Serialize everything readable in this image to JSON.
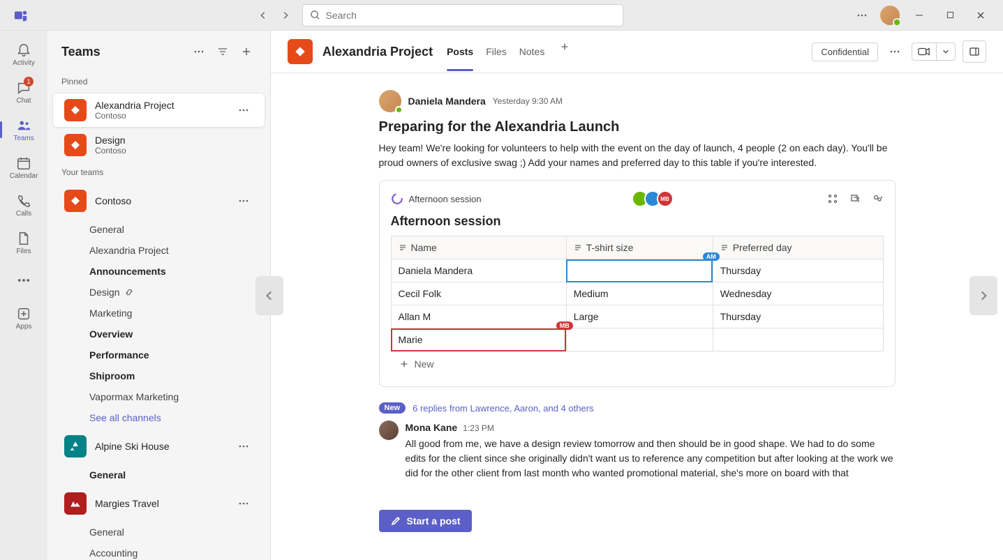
{
  "titlebar": {
    "search_placeholder": "Search"
  },
  "rail": {
    "activity": "Activity",
    "chat": "Chat",
    "chat_badge": "1",
    "teams": "Teams",
    "calendar": "Calendar",
    "calls": "Calls",
    "files": "Files",
    "apps": "Apps"
  },
  "sidebar": {
    "title": "Teams",
    "pinned_label": "Pinned",
    "your_teams_label": "Your teams",
    "pinned": [
      {
        "name": "Alexandria Project",
        "sub": "Contoso"
      },
      {
        "name": "Design",
        "sub": "Contoso"
      }
    ],
    "teams": [
      {
        "name": "Contoso",
        "channels": [
          {
            "label": "General",
            "bold": false
          },
          {
            "label": "Alexandria Project",
            "bold": false
          },
          {
            "label": "Announcements",
            "bold": true
          },
          {
            "label": "Design",
            "bold": false,
            "link": true
          },
          {
            "label": "Marketing",
            "bold": false
          },
          {
            "label": "Overview",
            "bold": true
          },
          {
            "label": "Performance",
            "bold": true
          },
          {
            "label": "Shiproom",
            "bold": true
          },
          {
            "label": "Vapormax Marketing",
            "bold": false
          }
        ],
        "see_all": "See all channels"
      },
      {
        "name": "Alpine Ski House",
        "channels": [
          {
            "label": "General",
            "bold": true
          }
        ]
      },
      {
        "name": "Margies Travel",
        "channels": [
          {
            "label": "General",
            "bold": false
          },
          {
            "label": "Accounting",
            "bold": false
          }
        ]
      }
    ]
  },
  "header": {
    "channel_title": "Alexandria Project",
    "tabs": {
      "posts": "Posts",
      "files": "Files",
      "notes": "Notes"
    },
    "confidential": "Confidential"
  },
  "post": {
    "author": "Daniela Mandera",
    "time": "Yesterday 9:30 AM",
    "title": "Preparing for the Alexandria Launch",
    "body": "Hey team! We're looking for volunteers to help with the event on the day of launch, 4 people (2 on each day). You'll be proud owners of exclusive swag ;) Add your names and preferred day to this table if you're interested.",
    "loop": {
      "label": "Afternoon session",
      "title": "Afternoon session",
      "columns": {
        "name": "Name",
        "tshirt": "T-shirt size",
        "day": "Preferred day"
      },
      "rows": [
        {
          "name": "Daniela Mandera",
          "tshirt": "",
          "day": "Thursday"
        },
        {
          "name": "Cecil Folk",
          "tshirt": "Medium",
          "day": "Wednesday"
        },
        {
          "name": "Allan M",
          "tshirt": "Large",
          "day": "Thursday"
        },
        {
          "name": "Marie",
          "tshirt": "",
          "day": ""
        }
      ],
      "cursor1": "AM",
      "cursor2": "MB",
      "add_row": "New"
    },
    "replies_label": "6 replies from Lawrence, Aaron, and 4 others",
    "new_label": "New",
    "reply": {
      "author": "Mona Kane",
      "time": "1:23 PM",
      "body": "All good from me, we have a design review tomorrow and then should be in good shape. We had to do some edits for the client since she originally didn't want us to reference any competition but after looking at the work we did for the other client from last month who wanted promotional material, she's more on board with that"
    }
  },
  "compose": {
    "start_post": "Start a post"
  }
}
